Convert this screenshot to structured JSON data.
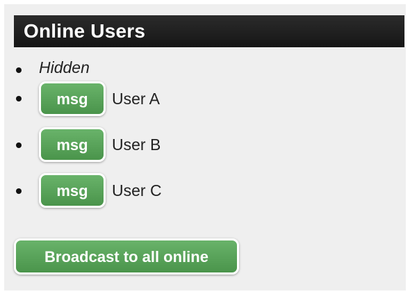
{
  "panel": {
    "title": "Online Users"
  },
  "users": {
    "hidden_label": "Hidden",
    "items": [
      {
        "button_label": "msg",
        "name": "User A"
      },
      {
        "button_label": "msg",
        "name": "User B"
      },
      {
        "button_label": "msg",
        "name": "User C"
      }
    ]
  },
  "broadcast": {
    "label": "Broadcast to all online"
  },
  "colors": {
    "header_bg": "#1e1e1e",
    "button_green": "#5aa65b",
    "panel_bg": "#efefef"
  }
}
